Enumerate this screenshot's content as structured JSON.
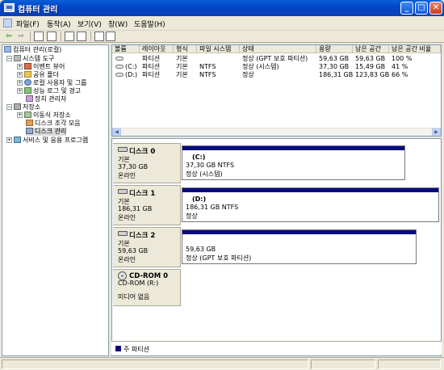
{
  "window": {
    "title": "컴퓨터 관리",
    "minimize": "_",
    "maximize": "□",
    "close": "✕"
  },
  "menu": [
    "파일(F)",
    "동작(A)",
    "보기(V)",
    "창(W)",
    "도움말(H)"
  ],
  "toolbar": {
    "back": "⇦",
    "forward": "⇨"
  },
  "tree": {
    "root": "컴퓨터 관리(로컬)",
    "system_tools": "시스템 도구",
    "event_viewer": "이벤트 뷰어",
    "shared_folders": "공유 폴더",
    "local_users": "로컬 사용자 및 그룹",
    "perf_logs": "성능 로그 및 경고",
    "device_manager": "장치 관리자",
    "storage": "저장소",
    "removable": "이동식 저장소",
    "defrag": "디스크 조각 모음",
    "disk_mgmt": "디스크 관리",
    "services": "서비스 및 응용 프로그램"
  },
  "volume_list": {
    "columns": [
      "볼륨",
      "레이아웃",
      "형식",
      "파일 시스템",
      "상태",
      "용량",
      "남은 공간",
      "남은 공간 비율"
    ],
    "rows": [
      [
        "",
        "파티션",
        "기본",
        "",
        "정상 (GPT 보호 파티션)",
        "59,63 GB",
        "59,63 GB",
        "100 %"
      ],
      [
        "(C:)",
        "파티션",
        "기본",
        "NTFS",
        "정상 (시스템)",
        "37,30 GB",
        "15,49 GB",
        "41 %"
      ],
      [
        "(D:)",
        "파티션",
        "기본",
        "NTFS",
        "정상",
        "186,31 GB",
        "123,83 GB",
        "66 %"
      ]
    ]
  },
  "disks": [
    {
      "name": "디스크 0",
      "type": "기본",
      "size": "37,30 GB",
      "status": "온라인",
      "partition": {
        "label": "(C:)",
        "size": "37,30 GB NTFS",
        "status": "정상 (시스템)"
      }
    },
    {
      "name": "디스크 1",
      "type": "기본",
      "size": "186,31 GB",
      "status": "온라인",
      "partition": {
        "label": "(D:)",
        "size": "186,31 GB NTFS",
        "status": "정상"
      }
    },
    {
      "name": "디스크 2",
      "type": "기본",
      "size": "59,63 GB",
      "status": "온라인",
      "partition": {
        "label": "",
        "size": "59,63 GB",
        "status": "정상 (GPT 보호 파티션)"
      }
    }
  ],
  "cdrom": {
    "name": "CD-ROM 0",
    "drive": "CD-ROM (R:)",
    "media": "미디어 없음"
  },
  "legend": {
    "label": "주 파티션",
    "color": "#0A0A80"
  }
}
